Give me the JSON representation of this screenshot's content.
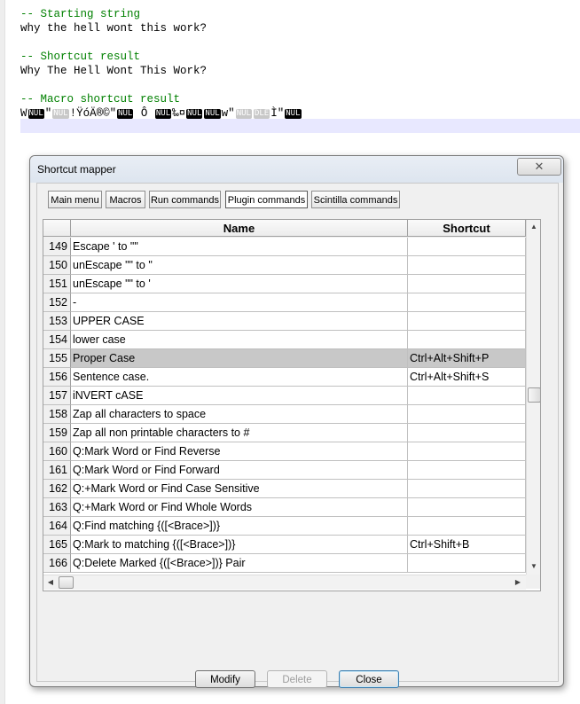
{
  "editor": {
    "comment1": "-- Starting string",
    "line1": "why the hell wont this work?",
    "comment2": "-- Shortcut result",
    "line2": "Why The Hell Wont This Work?",
    "comment3": "-- Macro shortcut result",
    "macro": {
      "t1": "W",
      "c1": "NUL",
      "t2": "\"",
      "c2": "NUL",
      "t3": "!ŸóÄ®©\"",
      "c3": "NUL",
      "t4": " Ô ",
      "c4": "NUL",
      "t5": "‰¤",
      "c5": "NUL",
      "c6": "NUL",
      "t6": "w\"",
      "c7": "NUL",
      "c8": "DLE",
      "t7": "Ì\"",
      "c9": "NUL"
    }
  },
  "dialog": {
    "title": "Shortcut mapper",
    "close_glyph": "✕",
    "tabs": [
      "Main menu",
      "Macros",
      "Run commands",
      "Plugin commands",
      "Scintilla commands"
    ],
    "active_tab": "Plugin commands",
    "columns": {
      "name": "Name",
      "shortcut": "Shortcut"
    },
    "rows": [
      {
        "num": "149",
        "name": "Escape ' to \"\"",
        "shortcut": ""
      },
      {
        "num": "150",
        "name": "unEscape \"\" to \"",
        "shortcut": ""
      },
      {
        "num": "151",
        "name": "unEscape \"\" to '",
        "shortcut": ""
      },
      {
        "num": "152",
        "name": "-",
        "shortcut": ""
      },
      {
        "num": "153",
        "name": "UPPER CASE",
        "shortcut": ""
      },
      {
        "num": "154",
        "name": "lower case",
        "shortcut": ""
      },
      {
        "num": "155",
        "name": "Proper Case",
        "shortcut": "Ctrl+Alt+Shift+P",
        "selected": true
      },
      {
        "num": "156",
        "name": "Sentence case.",
        "shortcut": "Ctrl+Alt+Shift+S"
      },
      {
        "num": "157",
        "name": "iNVERT cASE",
        "shortcut": ""
      },
      {
        "num": "158",
        "name": "Zap all characters to space",
        "shortcut": ""
      },
      {
        "num": "159",
        "name": "Zap all non printable characters to #",
        "shortcut": ""
      },
      {
        "num": "160",
        "name": "Q:Mark Word or Find Reverse",
        "shortcut": ""
      },
      {
        "num": "161",
        "name": "Q:Mark Word or Find Forward",
        "shortcut": ""
      },
      {
        "num": "162",
        "name": "Q:+Mark Word or Find Case Sensitive",
        "shortcut": ""
      },
      {
        "num": "163",
        "name": "Q:+Mark Word or Find Whole Words",
        "shortcut": ""
      },
      {
        "num": "164",
        "name": "Q:Find matching {([<Brace>])}",
        "shortcut": ""
      },
      {
        "num": "165",
        "name": "Q:Mark to matching {([<Brace>])}",
        "shortcut": "Ctrl+Shift+B"
      },
      {
        "num": "166",
        "name": "Q:Delete Marked {([<Brace>])} Pair",
        "shortcut": ""
      }
    ],
    "buttons": {
      "modify": "Modify",
      "delete": "Delete",
      "close": "Close"
    }
  }
}
